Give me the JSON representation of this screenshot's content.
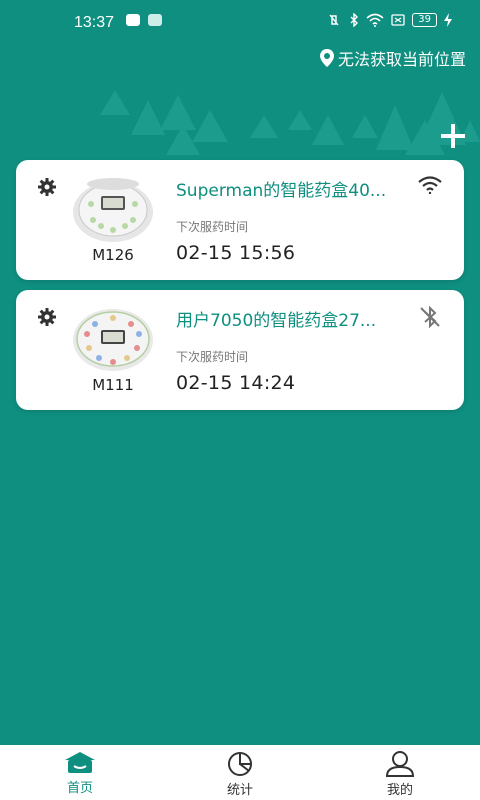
{
  "status_bar": {
    "time": "13:37",
    "battery": "39"
  },
  "header": {
    "location_text": "无法获取当前位置"
  },
  "devices": [
    {
      "name": "Superman的智能药盒40...",
      "model": "M126",
      "next_label": "下次服药时间",
      "next_time": "02-15 15:56",
      "connection_icon": "wifi-icon"
    },
    {
      "name": "用户7050的智能药盒27...",
      "model": "M111",
      "next_label": "下次服药时间",
      "next_time": "02-15 14:24",
      "connection_icon": "bluetooth-off-icon"
    }
  ],
  "tabs": [
    {
      "label": "首页",
      "icon": "home-icon",
      "active": true
    },
    {
      "label": "统计",
      "icon": "pie-chart-icon",
      "active": false
    },
    {
      "label": "我的",
      "icon": "user-icon",
      "active": false
    }
  ],
  "colors": {
    "primary": "#0f8f80",
    "card": "#ffffff",
    "text_dark": "#222222",
    "text_muted": "#777777"
  }
}
